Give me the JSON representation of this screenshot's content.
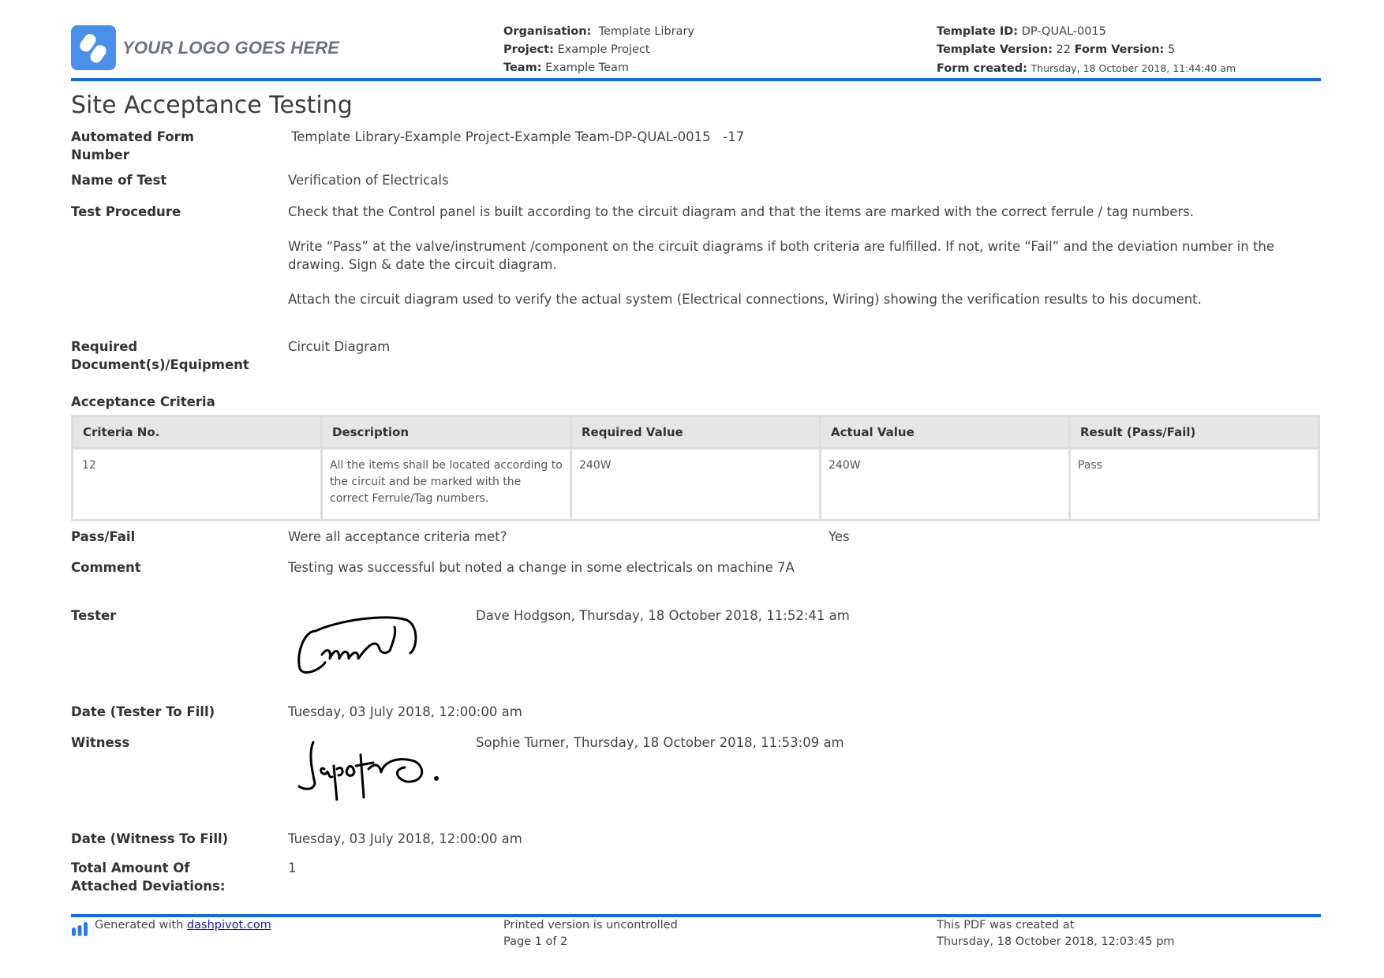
{
  "header": {
    "logo_text": "YOUR LOGO GOES HERE",
    "organisation_label": "Organisation:",
    "organisation_value": "Template Library",
    "project_label": "Project:",
    "project_value": "Example Project",
    "team_label": "Team:",
    "team_value": "Example Team",
    "template_id_label": "Template ID:",
    "template_id_value": "DP-QUAL-0015",
    "template_version_label": "Template Version:",
    "template_version_value": "22",
    "form_version_label": "Form Version:",
    "form_version_value": "5",
    "form_created_label": "Form created:",
    "form_created_value": "Thursday, 18 October 2018, 11:44:40 am",
    "accent_color": "#1a6bd0"
  },
  "title": "Site Acceptance Testing",
  "fields": {
    "form_number": {
      "label": "Automated Form Number",
      "value": "Template Library-Example Project-Example Team-DP-QUAL-0015   -17"
    },
    "name_of_test": {
      "label": "Name of Test",
      "value": "Verification of Electricals"
    },
    "test_procedure": {
      "label": "Test Procedure",
      "paragraphs": [
        "Check that the Control panel is built according to the circuit diagram and that the items are marked with the correct ferrule / tag numbers.",
        "Write “Pass” at the valve/instrument /component on the circuit diagrams if both criteria are fulfilled. If not, write “Fail” and the deviation number in the drawing. Sign & date the circuit diagram.",
        "Attach the circuit diagram used to verify the actual system (Electrical connections, Wiring) showing the verification results to his document."
      ]
    },
    "required_docs": {
      "label": "Required Document(s)/Equipment",
      "value": "Circuit Diagram"
    },
    "pass_fail": {
      "label": "Pass/Fail",
      "question": "Were all acceptance criteria met?",
      "value": "Yes"
    },
    "comment": {
      "label": "Comment",
      "value": "Testing was successful but noted a change in some electricals on machine 7A"
    },
    "tester": {
      "label": "Tester",
      "value": "Dave Hodgson, Thursday, 18 October 2018, 11:52:41 am",
      "signature_icon": "tester-signature"
    },
    "date_tester": {
      "label": "Date (Tester To Fill)",
      "value": "Tuesday, 03 July 2018, 12:00:00 am"
    },
    "witness": {
      "label": "Witness",
      "value": "Sophie Turner, Thursday, 18 October 2018, 11:53:09 am",
      "signature_icon": "witness-signature"
    },
    "date_witness": {
      "label": "Date (Witness To Fill)",
      "value": "Tuesday, 03 July 2018, 12:00:00 am"
    },
    "deviations": {
      "label": "Total Amount Of Attached Deviations:",
      "value": "1"
    }
  },
  "acceptance_criteria": {
    "heading": "Acceptance Criteria",
    "columns": [
      "Criteria No.",
      "Description",
      "Required Value",
      "Actual Value",
      "Result (Pass/Fail)"
    ],
    "rows": [
      [
        "12",
        "All the items shall be located according to the circuit and be marked with the correct Ferrule/Tag numbers.",
        "240W",
        "240W",
        "Pass"
      ]
    ]
  },
  "footer": {
    "generated_prefix": "Generated with",
    "generated_link": "dashpivot.com",
    "uncontrolled": "Printed version is uncontrolled",
    "page": "Page 1 of 2",
    "pdf_created_label": "This PDF was created at",
    "pdf_created_value": "Thursday, 18 October 2018, 12:03:45 pm"
  }
}
